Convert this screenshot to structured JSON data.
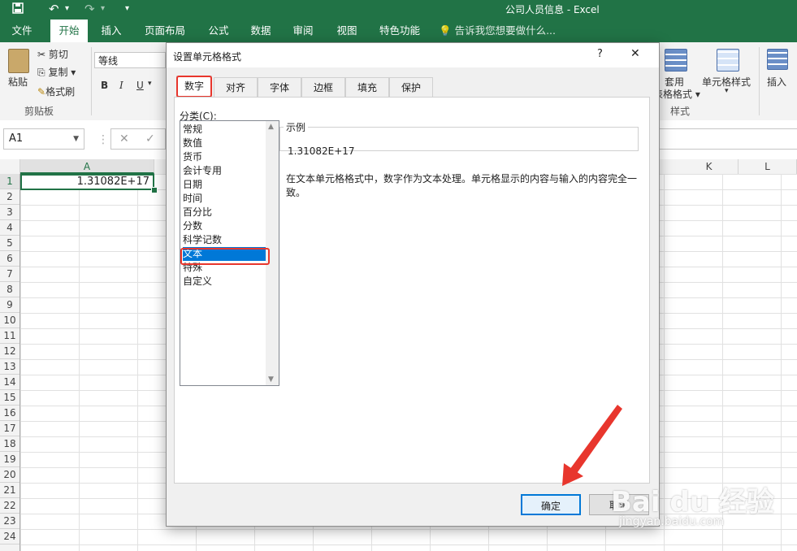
{
  "window": {
    "title": "公司人员信息 - Excel"
  },
  "ribbon_tabs": [
    "文件",
    "开始",
    "插入",
    "页面布局",
    "公式",
    "数据",
    "审阅",
    "视图",
    "特色功能"
  ],
  "active_tab": "开始",
  "tell_me": "告诉我您想要做什么...",
  "clipboard": {
    "paste": "粘贴",
    "cut": "剪切",
    "copy": "复制",
    "format_painter": "格式刷",
    "group": "剪贴板"
  },
  "font": {
    "name": "等线",
    "bold": "B",
    "italic": "I",
    "underline": "U"
  },
  "styles": {
    "table_format_1": "套用",
    "table_format_2": "表格格式",
    "cell_styles": "单元格样式",
    "group": "样式",
    "insert": "插入"
  },
  "name_box": "A1",
  "columns": [
    "A",
    "K",
    "L"
  ],
  "rows": [
    "1",
    "2",
    "3",
    "4",
    "5",
    "6",
    "7",
    "8",
    "9",
    "10",
    "11",
    "12",
    "13",
    "14",
    "15",
    "16",
    "17",
    "18",
    "19",
    "20",
    "21",
    "22",
    "23",
    "24"
  ],
  "cell_a1": "1.31082E+17",
  "dialog": {
    "title": "设置单元格格式",
    "help": "?",
    "close": "✕",
    "tabs": [
      "数字",
      "对齐",
      "字体",
      "边框",
      "填充",
      "保护"
    ],
    "category_label": "分类(C):",
    "categories": [
      "常规",
      "数值",
      "货币",
      "会计专用",
      "日期",
      "时间",
      "百分比",
      "分数",
      "科学记数",
      "文本",
      "特殊",
      "自定义"
    ],
    "selected_category": "文本",
    "sample_label": "示例",
    "sample_value": "1.31082E+17",
    "description": "在文本单元格格式中，数字作为文本处理。单元格显示的内容与输入的内容完全一致。",
    "ok": "确定",
    "cancel": "取消"
  },
  "watermark": {
    "brand": "Bai du 经验",
    "url": "jingyan.baidu.com"
  },
  "colors": {
    "excel_green": "#217346",
    "highlight": "#e8362d",
    "selection": "#0078d7"
  }
}
